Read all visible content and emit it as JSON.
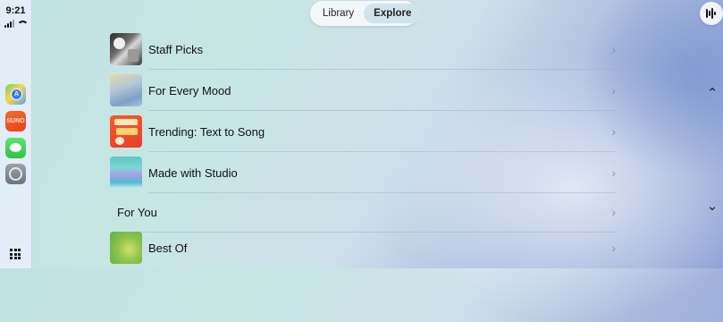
{
  "status_bar": {
    "time": "9:21"
  },
  "dock": {
    "apps": [
      {
        "name": "Maps",
        "icon": "maps-icon"
      },
      {
        "name": "Suno",
        "icon": "suno-icon",
        "text": "SUNO"
      },
      {
        "name": "Messages",
        "icon": "messages-icon"
      },
      {
        "name": "Settings",
        "icon": "settings-icon"
      }
    ],
    "app_grid_icon": "app-grid-icon"
  },
  "segmented": {
    "tabs": [
      {
        "label": "Library",
        "active": false
      },
      {
        "label": "Explore",
        "active": true
      }
    ]
  },
  "top_right_icon": "audio-waveform-icon",
  "list": {
    "rows": [
      {
        "label": "Staff Picks",
        "thumb": "staff-picks-thumbnail"
      },
      {
        "label": "For Every Mood",
        "thumb": "for-every-mood-thumbnail"
      },
      {
        "label": "Trending: Text to Song",
        "thumb": "trending-thumbnail"
      },
      {
        "label": "Made with Studio",
        "thumb": "made-with-studio-thumbnail"
      },
      {
        "label": "For You",
        "section": true
      },
      {
        "label": "Best Of",
        "thumb": "best-of-thumbnail"
      }
    ],
    "chevron": "›"
  },
  "scroll": {
    "up_glyph": "⌃",
    "down_glyph": "⌄"
  },
  "colors": {
    "accent_active_tab": "#cde4ea",
    "dock_bg": "#e4eef8"
  }
}
